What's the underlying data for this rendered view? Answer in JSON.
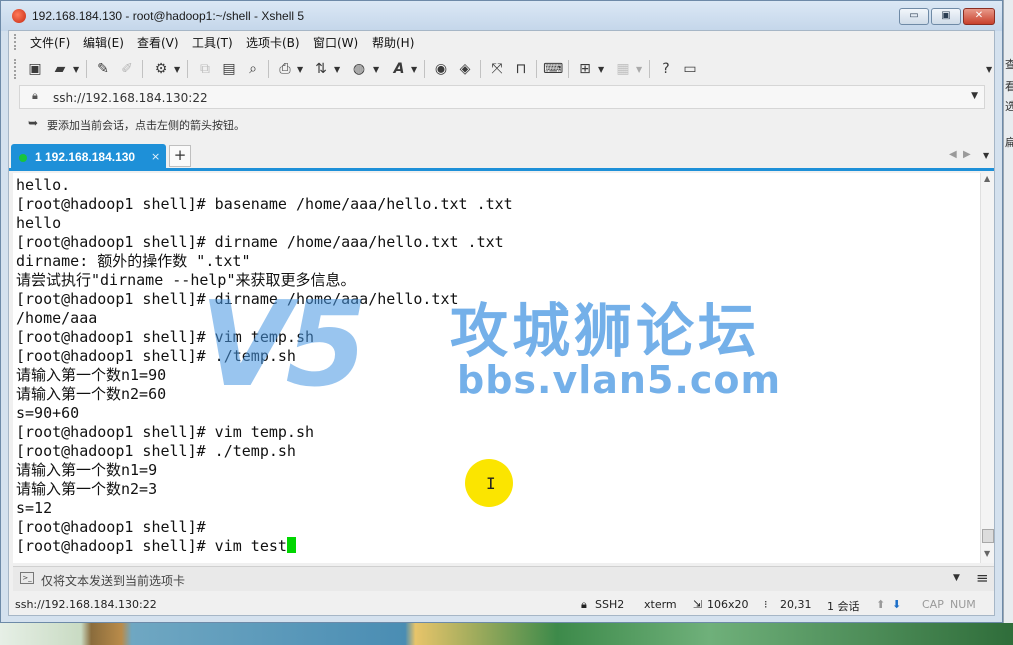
{
  "window": {
    "title": "192.168.184.130 - root@hadoop1:~/shell - Xshell 5",
    "min_label": "▭",
    "max_label": "▣",
    "close_label": "✕"
  },
  "menu": {
    "file": "文件(F)",
    "edit": "编辑(E)",
    "view": "查看(V)",
    "tools": "工具(T)",
    "tab": "选项卡(B)",
    "window": "窗口(W)",
    "help": "帮助(H)"
  },
  "address": {
    "value": "ssh://192.168.184.130:22"
  },
  "hint": {
    "text": "要添加当前会话，点击左侧的箭头按钮。"
  },
  "tab": {
    "label": "1 192.168.184.130",
    "close": "×",
    "add": "+"
  },
  "terminal": {
    "lines": [
      "hello.",
      "[root@hadoop1 shell]# basename /home/aaa/hello.txt .txt",
      "hello",
      "[root@hadoop1 shell]# dirname /home/aaa/hello.txt .txt",
      "dirname: 额外的操作数 \".txt\"",
      "请尝试执行\"dirname --help\"来获取更多信息。",
      "[root@hadoop1 shell]# dirname /home/aaa/hello.txt",
      "/home/aaa",
      "[root@hadoop1 shell]# vim temp.sh",
      "[root@hadoop1 shell]# ./temp.sh",
      "请输入第一个数n1=90",
      "请输入第一个数n2=60",
      "s=90+60",
      "[root@hadoop1 shell]# vim temp.sh",
      "[root@hadoop1 shell]# ./temp.sh",
      "请输入第一个数n1=9",
      "请输入第一个数n2=3",
      "s=12",
      "[root@hadoop1 shell]#"
    ],
    "prompt_line": "[root@hadoop1 shell]# vim test"
  },
  "watermark": {
    "logo": "V5",
    "name": "攻城狮论坛",
    "url": "bbs.vlan5.com"
  },
  "sendbar": {
    "placeholder": "仅将文本发送到当前选项卡"
  },
  "status": {
    "connection": "ssh://192.168.184.130:22",
    "protocol": "SSH2",
    "terminal": "xterm",
    "size": "106x20",
    "position": "20,31",
    "sessions": "1 会话",
    "cap": "CAP",
    "num": "NUM"
  },
  "desktop": {
    "right_chars": [
      "查",
      "看",
      "选",
      "扁"
    ]
  },
  "colors": {
    "tab_accent": "#1e90d8",
    "cursor": "#00d600",
    "highlight": "#fbe500"
  }
}
